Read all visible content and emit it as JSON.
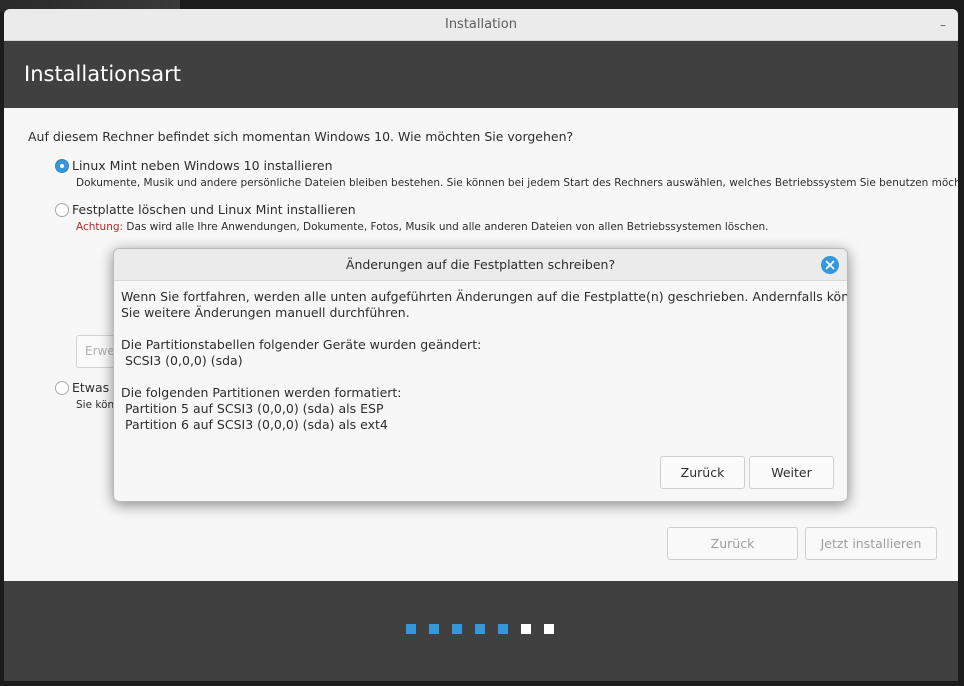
{
  "window": {
    "title": "Installation",
    "minimize_glyph": "–"
  },
  "header": {
    "title": "Installationsart"
  },
  "main": {
    "question": "Auf diesem Rechner befindet sich momentan Windows 10. Wie möchten Sie vorgehen?",
    "options": [
      {
        "label": "Linux Mint neben Windows 10 installieren",
        "description": "Dokumente, Musik und andere persönliche Dateien bleiben bestehen. Sie können bei jedem Start des Rechners auswählen, welches Betriebssystem Sie benutzen möchten.",
        "selected": true
      },
      {
        "label": "Festplatte löschen und Linux Mint installieren",
        "warning_label": "Achtung:",
        "description": " Das wird alle Ihre Anwendungen, Dokumente, Fotos, Musik und alle anderen Dateien von allen Betriebssystemen löschen.",
        "selected": false
      },
      {
        "label": "Etwas A",
        "description": "Sie kön",
        "selected": false
      }
    ],
    "advanced_button_label": "Erwei",
    "back_button": "Zurück",
    "install_button": "Jetzt installieren"
  },
  "footer": {
    "progress_steps_total": 7,
    "progress_steps_done": 5,
    "active_color": "#3498db",
    "inactive_color": "#ffffff"
  },
  "dialog": {
    "title": "Änderungen auf die Festplatten schreiben?",
    "intro_line1": "Wenn Sie fortfahren, werden alle unten aufgeführten Änderungen auf die Festplatte(n) geschrieben. Andernfalls können",
    "intro_line2": "Sie weitere Änderungen manuell durchführen.",
    "partition_tables_heading": "Die Partitionstabellen folgender Geräte wurden geändert:",
    "partition_tables": [
      " SCSI3 (0,0,0) (sda)"
    ],
    "format_heading": "Die folgenden Partitionen werden formatiert:",
    "format_list": [
      " Partition 5 auf SCSI3 (0,0,0) (sda) als ESP",
      " Partition 6 auf SCSI3 (0,0,0) (sda) als ext4"
    ],
    "back_button": "Zurück",
    "continue_button": "Weiter"
  },
  "colors": {
    "accent": "#3498db",
    "header_bg": "#404040",
    "warning": "#b32a2a"
  }
}
